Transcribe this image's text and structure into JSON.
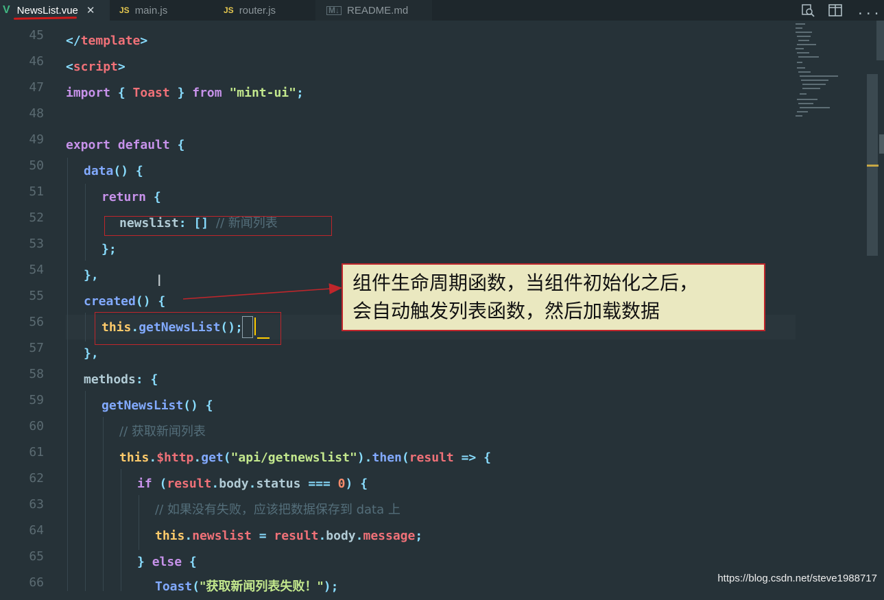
{
  "tabs": [
    {
      "label": "NewsList.vue",
      "icon": "vue-file-icon",
      "active": true
    },
    {
      "label": "main.js",
      "icon_text": "JS",
      "active": false
    },
    {
      "label": "router.js",
      "icon_text": "JS",
      "active": false
    },
    {
      "label": "README.md",
      "icon_text": "M↓",
      "active": false
    }
  ],
  "toolbar": {
    "split_editor": "split-editor-icon",
    "more": "..."
  },
  "line_numbers": [
    "45",
    "46",
    "47",
    "48",
    "49",
    "50",
    "51",
    "52",
    "53",
    "54",
    "55",
    "56",
    "57",
    "58",
    "59",
    "60",
    "61",
    "62",
    "63",
    "64",
    "65",
    "66"
  ],
  "code": {
    "l45": {
      "a": "</",
      "b": "template",
      "c": ">"
    },
    "l46": {
      "a": "<",
      "b": "script",
      "c": ">"
    },
    "l47": {
      "a": "import",
      "b": " { ",
      "c": "Toast",
      "d": " } ",
      "e": "from",
      "f": " \"mint-ui\"",
      "g": ";"
    },
    "l49": {
      "a": "export default",
      "b": " {"
    },
    "l50": {
      "a": "data",
      "b": "() {"
    },
    "l51": {
      "a": "return",
      "b": " {"
    },
    "l52": {
      "a": "newslist",
      "b": ": [] ",
      "c": "// 新闻列表"
    },
    "l53": {
      "a": "};"
    },
    "l54": {
      "a": "},"
    },
    "l55": {
      "a": "created",
      "b": "() {"
    },
    "l56": {
      "a": "this",
      "b": ".",
      "c": "getNewsList",
      "d": "()",
      "e": ";"
    },
    "l57": {
      "a": "},"
    },
    "l58": {
      "a": "methods",
      "b": ": {"
    },
    "l59": {
      "a": "getNewsList",
      "b": "() {"
    },
    "l60": {
      "a": "// 获取新闻列表"
    },
    "l61": {
      "a": "this",
      "b": ".",
      "c": "$http",
      "d": ".",
      "e": "get",
      "f": "(",
      "g": "\"api/getnewslist\"",
      "h": ").",
      "i": "then",
      "j": "(",
      "k": "result",
      "l": " => {"
    },
    "l62": {
      "a": "if",
      "b": " (",
      "c": "result",
      "d": ".",
      "e": "body",
      "f": ".",
      "g": "status",
      "h": " === ",
      "i": "0",
      "j": ") {"
    },
    "l63": {
      "a": "// 如果没有失败，应该把数据保存到 data 上"
    },
    "l64": {
      "a": "this",
      "b": ".",
      "c": "newslist",
      "d": " = ",
      "e": "result",
      "f": ".",
      "g": "body",
      "h": ".",
      "i": "message",
      "j": ";"
    },
    "l65": {
      "a": "} ",
      "b": "else",
      "c": " {"
    },
    "l66": {
      "a": "Toast",
      "b": "(",
      "c": "\"获取新闻列表失败！\"",
      "d": ");"
    }
  },
  "callout": {
    "line1": "组件生命周期函数，当组件初始化之后，",
    "line2": "会自动触发列表函数，然后加载数据"
  },
  "watermark": "https://blog.csdn.net/steve1988717"
}
